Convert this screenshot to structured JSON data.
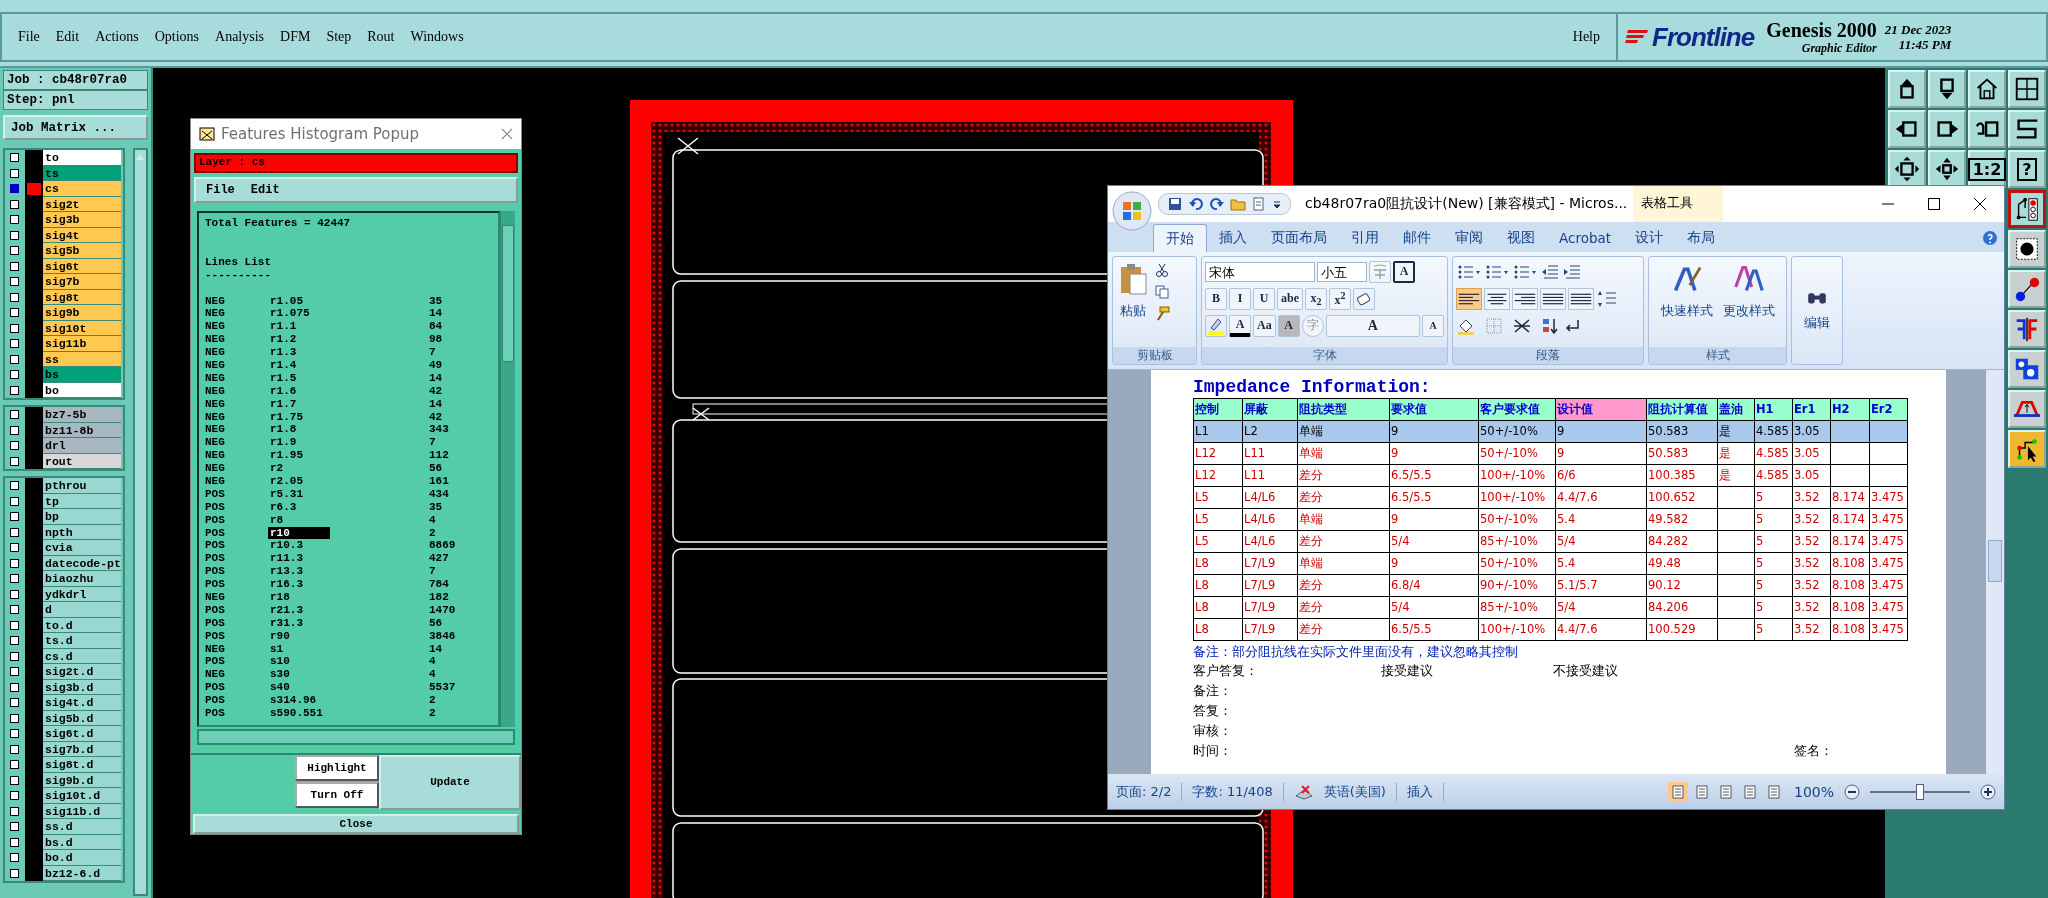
{
  "app_menu": {
    "items": [
      "File",
      "Edit",
      "Actions",
      "Options",
      "Analysis",
      "DFM",
      "Step",
      "Rout",
      "Windows"
    ],
    "help": "Help"
  },
  "brand": {
    "logo": "Frontline",
    "product": "Genesis 2000",
    "subtitle": "Graphic Editor",
    "date": "21 Dec 2023",
    "time": "11:45 PM"
  },
  "job_panel": {
    "job": "Job : cb48r07ra0",
    "step": "Step: pnl",
    "matrix_button": "Job Matrix ...",
    "layer_groups": [
      {
        "layers": [
          {
            "name": "to",
            "color": "#ffffff",
            "selected": false
          },
          {
            "name": "ts",
            "color": "#00a078",
            "selected": false
          },
          {
            "name": "cs",
            "color": "#ffc850",
            "selected": true
          },
          {
            "name": "sig2t",
            "color": "#ffc850",
            "selected": false
          },
          {
            "name": "sig3b",
            "color": "#ffc850",
            "selected": false
          },
          {
            "name": "sig4t",
            "color": "#ffc850",
            "selected": false
          },
          {
            "name": "sig5b",
            "color": "#ffc850",
            "selected": false
          },
          {
            "name": "sig6t",
            "color": "#ffc850",
            "selected": false
          },
          {
            "name": "sig7b",
            "color": "#ffc850",
            "selected": false
          },
          {
            "name": "sig8t",
            "color": "#ffc850",
            "selected": false
          },
          {
            "name": "sig9b",
            "color": "#ffc850",
            "selected": false
          },
          {
            "name": "sig10t",
            "color": "#ffc850",
            "selected": false
          },
          {
            "name": "sig11b",
            "color": "#ffc850",
            "selected": false
          },
          {
            "name": "ss",
            "color": "#ffc850",
            "selected": false
          },
          {
            "name": "bs",
            "color": "#00a078",
            "selected": false
          },
          {
            "name": "bo",
            "color": "#ffffff",
            "selected": false
          }
        ]
      },
      {
        "layers": [
          {
            "name": "bz7-5b",
            "color": "#a8b8c0",
            "selected": false
          },
          {
            "name": "bz11-8b",
            "color": "#a8b8c0",
            "selected": false
          },
          {
            "name": "drl",
            "color": "#a8b8c0",
            "selected": false
          },
          {
            "name": "rout",
            "color": "#d8d8d8",
            "selected": false
          }
        ]
      },
      {
        "layers": [
          {
            "name": "pthrou",
            "color": "#99d8d0",
            "selected": false
          },
          {
            "name": "tp",
            "color": "#99d8d0",
            "selected": false
          },
          {
            "name": "bp",
            "color": "#99d8d0",
            "selected": false
          },
          {
            "name": "npth",
            "color": "#99d8d0",
            "selected": false
          },
          {
            "name": "cvia",
            "color": "#99d8d0",
            "selected": false
          },
          {
            "name": "datecode-pt",
            "color": "#99d8d0",
            "selected": false
          },
          {
            "name": "biaozhu",
            "color": "#99d8d0",
            "selected": false
          },
          {
            "name": "ydkdrl",
            "color": "#99d8d0",
            "selected": false
          },
          {
            "name": "d",
            "color": "#99d8d0",
            "selected": false
          },
          {
            "name": "to.d",
            "color": "#99d8d0",
            "selected": false
          },
          {
            "name": "ts.d",
            "color": "#99d8d0",
            "selected": false
          },
          {
            "name": "cs.d",
            "color": "#99d8d0",
            "selected": false
          },
          {
            "name": "sig2t.d",
            "color": "#99d8d0",
            "selected": false
          },
          {
            "name": "sig3b.d",
            "color": "#99d8d0",
            "selected": false
          },
          {
            "name": "sig4t.d",
            "color": "#99d8d0",
            "selected": false
          },
          {
            "name": "sig5b.d",
            "color": "#99d8d0",
            "selected": false
          },
          {
            "name": "sig6t.d",
            "color": "#99d8d0",
            "selected": false
          },
          {
            "name": "sig7b.d",
            "color": "#99d8d0",
            "selected": false
          },
          {
            "name": "sig8t.d",
            "color": "#99d8d0",
            "selected": false
          },
          {
            "name": "sig9b.d",
            "color": "#99d8d0",
            "selected": false
          },
          {
            "name": "sig10t.d",
            "color": "#99d8d0",
            "selected": false
          },
          {
            "name": "sig11b.d",
            "color": "#99d8d0",
            "selected": false
          },
          {
            "name": "ss.d",
            "color": "#99d8d0",
            "selected": false
          },
          {
            "name": "bs.d",
            "color": "#99d8d0",
            "selected": false
          },
          {
            "name": "bo.d",
            "color": "#99d8d0",
            "selected": false
          },
          {
            "name": "bz12-6.d",
            "color": "#99d8d0",
            "selected": false
          }
        ]
      }
    ]
  },
  "histogram": {
    "title": "Features Histogram Popup",
    "layer": "Layer :  cs",
    "menu": [
      "File",
      "Edit"
    ],
    "total": "Total Features = 42447",
    "list_title": "Lines List",
    "rule": "----------",
    "rows": [
      {
        "polarity": "NEG",
        "symbol": "r1.05",
        "count": "35",
        "selected": false
      },
      {
        "polarity": "NEG",
        "symbol": "r1.075",
        "count": "14",
        "selected": false
      },
      {
        "polarity": "NEG",
        "symbol": "r1.1",
        "count": "84",
        "selected": false
      },
      {
        "polarity": "NEG",
        "symbol": "r1.2",
        "count": "98",
        "selected": false
      },
      {
        "polarity": "NEG",
        "symbol": "r1.3",
        "count": "7",
        "selected": false
      },
      {
        "polarity": "NEG",
        "symbol": "r1.4",
        "count": "49",
        "selected": false
      },
      {
        "polarity": "NEG",
        "symbol": "r1.5",
        "count": "14",
        "selected": false
      },
      {
        "polarity": "NEG",
        "symbol": "r1.6",
        "count": "42",
        "selected": false
      },
      {
        "polarity": "NEG",
        "symbol": "r1.7",
        "count": "14",
        "selected": false
      },
      {
        "polarity": "NEG",
        "symbol": "r1.75",
        "count": "42",
        "selected": false
      },
      {
        "polarity": "NEG",
        "symbol": "r1.8",
        "count": "343",
        "selected": false
      },
      {
        "polarity": "NEG",
        "symbol": "r1.9",
        "count": "7",
        "selected": false
      },
      {
        "polarity": "NEG",
        "symbol": "r1.95",
        "count": "112",
        "selected": false
      },
      {
        "polarity": "NEG",
        "symbol": "r2",
        "count": "56",
        "selected": false
      },
      {
        "polarity": "NEG",
        "symbol": "r2.05",
        "count": "161",
        "selected": false
      },
      {
        "polarity": "POS",
        "symbol": "r5.31",
        "count": "434",
        "selected": false
      },
      {
        "polarity": "POS",
        "symbol": "r6.3",
        "count": "35",
        "selected": false
      },
      {
        "polarity": "POS",
        "symbol": "r8",
        "count": "4",
        "selected": false
      },
      {
        "polarity": "POS",
        "symbol": "r10",
        "count": "2",
        "selected": true
      },
      {
        "polarity": "POS",
        "symbol": "r10.3",
        "count": "8869",
        "selected": false
      },
      {
        "polarity": "POS",
        "symbol": "r11.3",
        "count": "427",
        "selected": false
      },
      {
        "polarity": "POS",
        "symbol": "r13.3",
        "count": "7",
        "selected": false
      },
      {
        "polarity": "POS",
        "symbol": "r16.3",
        "count": "784",
        "selected": false
      },
      {
        "polarity": "NEG",
        "symbol": "r18",
        "count": "182",
        "selected": false
      },
      {
        "polarity": "POS",
        "symbol": "r21.3",
        "count": "1470",
        "selected": false
      },
      {
        "polarity": "POS",
        "symbol": "r31.3",
        "count": "56",
        "selected": false
      },
      {
        "polarity": "POS",
        "symbol": "r90",
        "count": "3846",
        "selected": false
      },
      {
        "polarity": "NEG",
        "symbol": "s1",
        "count": "14",
        "selected": false
      },
      {
        "polarity": "POS",
        "symbol": "s10",
        "count": "4",
        "selected": false
      },
      {
        "polarity": "NEG",
        "symbol": "s30",
        "count": "4",
        "selected": false
      },
      {
        "polarity": "POS",
        "symbol": "s40",
        "count": "5537",
        "selected": false
      },
      {
        "polarity": "POS",
        "symbol": "s314.96",
        "count": "2",
        "selected": false
      },
      {
        "polarity": "POS",
        "symbol": "s590.551",
        "count": "2",
        "selected": false
      }
    ],
    "buttons": {
      "highlight": "Highlight",
      "turn_off": "Turn Off",
      "update": "Update",
      "close": "Close"
    }
  },
  "toolbar": {
    "grid": [
      {
        "kind": "up"
      },
      {
        "kind": "down"
      },
      {
        "kind": "home"
      },
      {
        "kind": "grid"
      },
      {
        "kind": "left"
      },
      {
        "kind": "right"
      },
      {
        "kind": "undo"
      },
      {
        "kind": "wave"
      },
      {
        "kind": "fit"
      },
      {
        "kind": "center"
      },
      {
        "kind": "text",
        "label": "1:2"
      },
      {
        "kind": "text",
        "label": "?"
      }
    ],
    "side": [
      {
        "kind": "traces",
        "on": true,
        "selected": false
      },
      {
        "kind": "pad",
        "on": false,
        "selected": false
      },
      {
        "kind": "connect",
        "on": false,
        "selected": false
      },
      {
        "kind": "flip",
        "on": false,
        "selected": false
      },
      {
        "kind": "shapes",
        "on": false,
        "selected": false
      },
      {
        "kind": "profile",
        "on": false,
        "selected": false
      },
      {
        "kind": "route",
        "on": false,
        "selected": true
      }
    ]
  },
  "word": {
    "title": "cb48r07ra0阻抗设计(New) [兼容模式] - Micros...",
    "context_tab": "表格工具",
    "tabs": [
      {
        "label": "开始",
        "selected": true
      },
      {
        "label": "插入",
        "selected": false
      },
      {
        "label": "页面布局",
        "selected": false
      },
      {
        "label": "引用",
        "selected": false
      },
      {
        "label": "邮件",
        "selected": false
      },
      {
        "label": "审阅",
        "selected": false
      },
      {
        "label": "视图",
        "selected": false
      },
      {
        "label": "Acrobat",
        "selected": false
      },
      {
        "label": "设计",
        "selected": false
      },
      {
        "label": "布局",
        "selected": false
      }
    ],
    "ribbon": {
      "clipboard": {
        "label": "剪贴板",
        "paste": "粘贴"
      },
      "font": {
        "label": "字体",
        "face": "宋体",
        "size": "小五",
        "border_button": "A",
        "format_buttons": [
          "B",
          "I",
          "U",
          "abe",
          "x$_{2}$",
          "x$^{2}$"
        ],
        "effect_buttons": [
          {
            "kind": "color",
            "label": "A"
          },
          {
            "kind": "case",
            "label": "Aa"
          },
          {
            "kind": "shade",
            "label": "A"
          },
          {
            "kind": "circle",
            "label": "字"
          },
          {
            "kind": "grow",
            "label": "A"
          },
          {
            "kind": "shrink",
            "label": "A"
          }
        ]
      },
      "paragraph": {
        "label": "段落",
        "align": [
          {
            "kind": "left",
            "selected": true
          },
          {
            "kind": "center",
            "selected": false
          },
          {
            "kind": "right",
            "selected": false
          },
          {
            "kind": "justify",
            "selected": false
          },
          {
            "kind": "distribute",
            "selected": false
          }
        ]
      },
      "styles": {
        "label": "样式",
        "quick": "快速样式",
        "change": "更改样式"
      },
      "editing": {
        "label": "编辑"
      }
    },
    "document": {
      "heading": "Impedance Information:",
      "columns": [
        {
          "label": "控制",
          "color": "#99ffcc"
        },
        {
          "label": "屏蔽",
          "color": "#99ffcc"
        },
        {
          "label": "阻抗类型",
          "color": "#99ffcc"
        },
        {
          "label": "要求值",
          "color": "#99ffcc"
        },
        {
          "label": "客户要求值",
          "color": "#99ffcc"
        },
        {
          "label": "设计值",
          "color": "#ff99cc"
        },
        {
          "label": "阻抗计算值",
          "color": "#99ffcc"
        },
        {
          "label": "盖油",
          "color": "#99ffcc"
        },
        {
          "label": "H1",
          "color": "#99ffcc"
        },
        {
          "label": "Er1",
          "color": "#99ffcc"
        },
        {
          "label": "H2",
          "color": "#99ffcc"
        },
        {
          "label": "Er2",
          "color": "#99ffcc"
        }
      ],
      "rows": [
        {
          "selected": true,
          "color": "#000000",
          "cells": [
            "L1",
            "L2",
            "单端",
            "9",
            "50+/-10%",
            "9",
            "50.583",
            "是",
            "4.585",
            "3.05",
            "",
            ""
          ]
        },
        {
          "selected": false,
          "color": "#cc0000",
          "cells": [
            "L12",
            "L11",
            "单端",
            "9",
            "50+/-10%",
            "9",
            "50.583",
            "是",
            "4.585",
            "3.05",
            "",
            ""
          ]
        },
        {
          "selected": false,
          "color": "#cc0000",
          "cells": [
            "L12",
            "L11",
            "差分",
            "6.5/5.5",
            "100+/-10%",
            "6/6",
            "100.385",
            "是",
            "4.585",
            "3.05",
            "",
            ""
          ]
        },
        {
          "selected": false,
          "color": "#cc0000",
          "cells": [
            "L5",
            "L4/L6",
            "差分",
            "6.5/5.5",
            "100+/-10%",
            "4.4/7.6",
            "100.652",
            "",
            "5",
            "3.52",
            "8.174",
            "3.475"
          ]
        },
        {
          "selected": false,
          "color": "#cc0000",
          "cells": [
            "L5",
            "L4/L6",
            "单端",
            "9",
            "50+/-10%",
            "5.4",
            "49.582",
            "",
            "5",
            "3.52",
            "8.174",
            "3.475"
          ]
        },
        {
          "selected": false,
          "color": "#cc0000",
          "cells": [
            "L5",
            "L4/L6",
            "差分",
            "5/4",
            "85+/-10%",
            "5/4",
            "84.282",
            "",
            "5",
            "3.52",
            "8.174",
            "3.475"
          ]
        },
        {
          "selected": false,
          "color": "#cc0000",
          "cells": [
            "L8",
            "L7/L9",
            "单端",
            "9",
            "50+/-10%",
            "5.4",
            "49.48",
            "",
            "5",
            "3.52",
            "8.108",
            "3.475"
          ]
        },
        {
          "selected": false,
          "color": "#cc0000",
          "cells": [
            "L8",
            "L7/L9",
            "差分",
            "6.8/4",
            "90+/-10%",
            "5.1/5.7",
            "90.12",
            "",
            "5",
            "3.52",
            "8.108",
            "3.475"
          ]
        },
        {
          "selected": false,
          "color": "#cc0000",
          "cells": [
            "L8",
            "L7/L9",
            "差分",
            "5/4",
            "85+/-10%",
            "5/4",
            "84.206",
            "",
            "5",
            "3.52",
            "8.108",
            "3.475"
          ]
        },
        {
          "selected": false,
          "color": "#cc0000",
          "cells": [
            "L8",
            "L7/L9",
            "差分",
            "6.5/5.5",
            "100+/-10%",
            "4.4/7.6",
            "100.529",
            "",
            "5",
            "3.52",
            "8.108",
            "3.475"
          ]
        }
      ],
      "note": "备注：部分阻抗线在实际文件里面没有，建议忽略其控制",
      "reply": {
        "label": "客户答复：",
        "accept": "接受建议",
        "reject": "不接受建议"
      },
      "fields": [
        "备注：",
        "答复：",
        "审核："
      ],
      "time_label": "时间：",
      "sign_label": "签名："
    },
    "status": {
      "page": "页面: 2/2",
      "words": "字数: 11/408",
      "language": "英语(美国)",
      "mode": "插入",
      "zoom": "100%",
      "zoom_slider": {
        "level": 0.5
      }
    }
  }
}
